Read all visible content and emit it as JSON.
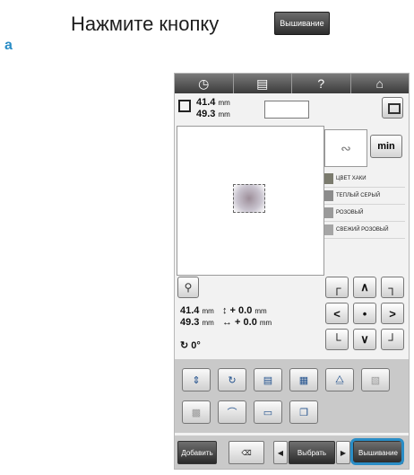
{
  "instruction": {
    "text": "Нажмите кнопку",
    "button_label": "Вышивание"
  },
  "step_label": "a",
  "device": {
    "topbar": [
      {
        "icon": "clock-icon",
        "glyph": "◷"
      },
      {
        "icon": "document-icon",
        "glyph": "▤"
      },
      {
        "icon": "help-icon",
        "glyph": "?"
      },
      {
        "icon": "home-icon",
        "glyph": "⌂"
      }
    ],
    "size": {
      "width": "41.4",
      "height": "49.3",
      "unit": "mm"
    },
    "min_label": "min",
    "colors": [
      "ЦВЕТ ХАКИ",
      "ТЕПЛЫЙ СЕРЫЙ",
      "РОЗОВЫЙ",
      "СВЕЖИЙ РОЗОВЫЙ"
    ],
    "position": {
      "size_w": "41.4",
      "size_h": "49.3",
      "offset_y": "0.0",
      "offset_x": "0.0",
      "unit": "mm",
      "rotation": "0°"
    },
    "arrows": [
      "┌",
      "∧",
      "┐",
      "<",
      "•",
      ">",
      "└",
      "∨",
      "┘"
    ],
    "bottom": {
      "add": "Добавить",
      "select": "Выбрать",
      "embroidery": "Вышивание"
    }
  }
}
